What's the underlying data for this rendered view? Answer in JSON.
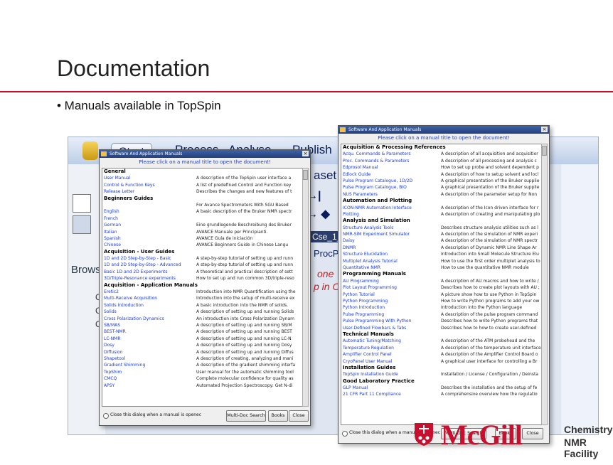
{
  "slide": {
    "title": "Documentation",
    "bullet": "• Manuals available in TopSpin"
  },
  "app": {
    "tabs": [
      "Start",
      "Process",
      "Analyse",
      "Publish"
    ],
    "partial": {
      "aset": "aset",
      "browse": "Brows",
      "dataset": "Cse_1_1",
      "procp": "ProcP"
    },
    "red1": "one",
    "red2": "p in CD",
    "tree_letters": [
      "C",
      "C",
      "C"
    ]
  },
  "colors": {
    "accent": "#c8102e",
    "link": "#1b3ad6",
    "titlebar": "#233e7a"
  },
  "dialog_left": {
    "title": "Software And Application Manuals",
    "instruction": "Please click on a manual title to open the document!",
    "rows": [
      {
        "t": "s",
        "n": "General"
      },
      {
        "t": "i",
        "n": "User Manual",
        "d": "A description of the TopSpin user interface a"
      },
      {
        "t": "i",
        "n": "Control & Function Keys",
        "d": "A list of predefined Control and Function key"
      },
      {
        "t": "i",
        "n": "Release Letter",
        "d": "Describes the changes and new features of t"
      },
      {
        "t": "s",
        "n": "Beginners Guides"
      },
      {
        "t": "i",
        "n": "",
        "d": "For Avance Spectrometers With SGU Based"
      },
      {
        "t": "i",
        "n": "English",
        "d": "A basic description of the Bruker NMR spectr"
      },
      {
        "t": "i",
        "n": "French",
        "d": ""
      },
      {
        "t": "i",
        "n": "German",
        "d": "Eine grundlegende Beschreibung des Bruker"
      },
      {
        "t": "i",
        "n": "Italian",
        "d": "AVANCE Manuale per Principianti."
      },
      {
        "t": "i",
        "n": "Spanish",
        "d": "AVANCE Guía de iniciación"
      },
      {
        "t": "i",
        "n": "Chinese",
        "d": "AVANCE Beginners Guide in Chinese Langu"
      },
      {
        "t": "s",
        "n": "Acquisition - User Guides"
      },
      {
        "t": "i",
        "n": "1D and 2D Step-by-Step - Basic",
        "d": "A step-by-step tutorial of setting up and runn"
      },
      {
        "t": "i",
        "n": "1D and 2D Step-by-Step - Advanced",
        "d": "A step-by-step tutorial of setting up and runn"
      },
      {
        "t": "i",
        "n": "Basic 1D and 2D Experiments",
        "d": "A theoretical and practical description of sett"
      },
      {
        "t": "i",
        "n": "3D/Triple-Resonance experiments",
        "d": "How to set up and run common 3D/triple-reso"
      },
      {
        "t": "s",
        "n": "Acquisition - Application Manuals"
      },
      {
        "t": "i",
        "n": "Eretic2",
        "d": "Introduction into NMR Quantification using the"
      },
      {
        "t": "i",
        "n": "Multi-Receive Acquisition",
        "d": "Introduction into the setup of multi-receive ex"
      },
      {
        "t": "i",
        "n": "Solids Introduction",
        "d": "A basic introduction into the NMR of solids."
      },
      {
        "t": "i",
        "n": "Solids",
        "d": "A description of setting up and running Solids"
      },
      {
        "t": "i",
        "n": "Cross Polarization Dynamics",
        "d": "An introduction into Cross Polarization Dynam"
      },
      {
        "t": "i",
        "n": "SB/MAS",
        "d": "A description of setting up and running SB/M"
      },
      {
        "t": "i",
        "n": "BEST-NMR",
        "d": "A description of setting up and running BEST"
      },
      {
        "t": "i",
        "n": "LC-NMR",
        "d": "A description of setting up and running LC-N"
      },
      {
        "t": "i",
        "n": "Dosy",
        "d": "A description of setting up and running Dosy"
      },
      {
        "t": "i",
        "n": "Diffusion",
        "d": "A description of setting up and running Diffus"
      },
      {
        "t": "i",
        "n": "Shapetool",
        "d": "A description of creating, analyzing and mani"
      },
      {
        "t": "i",
        "n": "Gradient Shimming",
        "d": "A description of the gradient shimming interfa"
      },
      {
        "t": "i",
        "n": "TopShim",
        "d": "User manual for the automatic shimming tool"
      },
      {
        "t": "i",
        "n": "CMCQ",
        "d": "Complete molecular confidence for quality as"
      },
      {
        "t": "i",
        "n": "APSY",
        "d": "Automated Projection Spectroscopy: Get N-di"
      }
    ],
    "footer": {
      "close_label": "Close this dialog when a manual is openec",
      "multi": "Multi-Doc Search",
      "books": "Books",
      "close": "Close"
    }
  },
  "dialog_right": {
    "title": "Software And Application Manuals",
    "instruction": "Please click on a manual title to open the document!",
    "rows": [
      {
        "t": "s",
        "n": "Acquisition & Processing References"
      },
      {
        "t": "i",
        "n": "Acqu. Commands & Parameters",
        "d": "A description of all acquisition and acquisitior"
      },
      {
        "t": "i",
        "n": "Proc. Commands & Parameters",
        "d": "A description of all processing and analysis c"
      },
      {
        "t": "i",
        "n": "Edprosol Manual",
        "d": "How to set up probe and solvent dependent p"
      },
      {
        "t": "i",
        "n": "Edlock Guide",
        "d": "A description of how to setup solvent and locl"
      },
      {
        "t": "i",
        "n": "Pulse Program Catalogue, 1D/2D",
        "d": "A graphical presentation of the Bruker supplie"
      },
      {
        "t": "i",
        "n": "Pulse Program Catalogue, BIO",
        "d": "A graphical presentation of the Bruker supplie"
      },
      {
        "t": "i",
        "n": "NUS Parameters",
        "d": "A description of the parameter setup for Non"
      },
      {
        "t": "s",
        "n": "Automation and Plotting"
      },
      {
        "t": "i",
        "n": "ICON-NMR Automation Interface",
        "d": "A description of the Icon driven interface for r"
      },
      {
        "t": "i",
        "n": "Plotting",
        "d": "A description of creating and manipulating plo"
      },
      {
        "t": "s",
        "n": "Analysis and Simulation"
      },
      {
        "t": "i",
        "n": "Structure Analysis Tools",
        "d": "Describes structure analysis utilities such as l"
      },
      {
        "t": "i",
        "n": "NMR-SIM Experiment Simulator",
        "d": "A description of the simulation of NMR experi"
      },
      {
        "t": "i",
        "n": "Daisy",
        "d": "A description of the simulation of NMR spectr"
      },
      {
        "t": "i",
        "n": "DNMR",
        "d": "A description of Dynamic NMR Line Shape Ar"
      },
      {
        "t": "i",
        "n": "Structure Elucidation",
        "d": "Introduction into Small Molecule Structure Elu"
      },
      {
        "t": "i",
        "n": "Multiplet Analysis Tutorial",
        "d": "How to use the first order multiplet analysis to"
      },
      {
        "t": "i",
        "n": "Quantitative NMR",
        "d": "How to use the quantitative NMR module"
      },
      {
        "t": "s",
        "n": "Programming Manuals"
      },
      {
        "t": "i",
        "n": "AU Programming",
        "d": "A description of AU macros and how to write /"
      },
      {
        "t": "i",
        "n": "Plot Layout Programming",
        "d": "Describes how to create plot layouts with AU ;"
      },
      {
        "t": "i",
        "n": "Python Tutorial",
        "d": "A picture show how to use Python in TopSpin"
      },
      {
        "t": "i",
        "n": "Python Programming",
        "d": "How to write Python programs to add your ow"
      },
      {
        "t": "i",
        "n": "Python Introduction",
        "d": "Introduction into the Python language"
      },
      {
        "t": "i",
        "n": "Pulse Programming",
        "d": "A description of the pulse program command"
      },
      {
        "t": "i",
        "n": "Pulse Programming With Python",
        "d": "Describes how to write Python programs that"
      },
      {
        "t": "i",
        "n": "User-Defined Flowbars & Tabs",
        "d": "Describes how to how to create user-defined"
      },
      {
        "t": "s",
        "n": "Technical Manuals"
      },
      {
        "t": "i",
        "n": "Automatic Tuning/Matching",
        "d": "A description of the ATM probehead and the"
      },
      {
        "t": "i",
        "n": "Temperature Regulation",
        "d": "A description of the temperature unit interface"
      },
      {
        "t": "i",
        "n": "Amplifier Control Panel",
        "d": "A description of the Amplifier Control Board o"
      },
      {
        "t": "i",
        "n": "CryoPanel User Manual",
        "d": "A graphical user interface for controlling a Br"
      },
      {
        "t": "s",
        "n": "Installation Guides"
      },
      {
        "t": "i",
        "n": "TopSpin Installation Guide",
        "d": "Installation / License / Configuration / Deinsta"
      },
      {
        "t": "s",
        "n": "Good Laboratory Practice"
      },
      {
        "t": "i",
        "n": "GLP Manual",
        "d": "Describes the installation and the setup of fe"
      },
      {
        "t": "i",
        "n": "21 CFR Part 11 Compliance",
        "d": "A comprehensive overview how the regulatio"
      }
    ],
    "footer": {
      "close_label": "Close this dialog when a manual is openec",
      "multi": "Multi-Doc Search",
      "books": "Books",
      "close": "Close"
    }
  },
  "logo": {
    "word": "McGill",
    "line1": "Chemistry",
    "line2": "NMR Facility"
  }
}
